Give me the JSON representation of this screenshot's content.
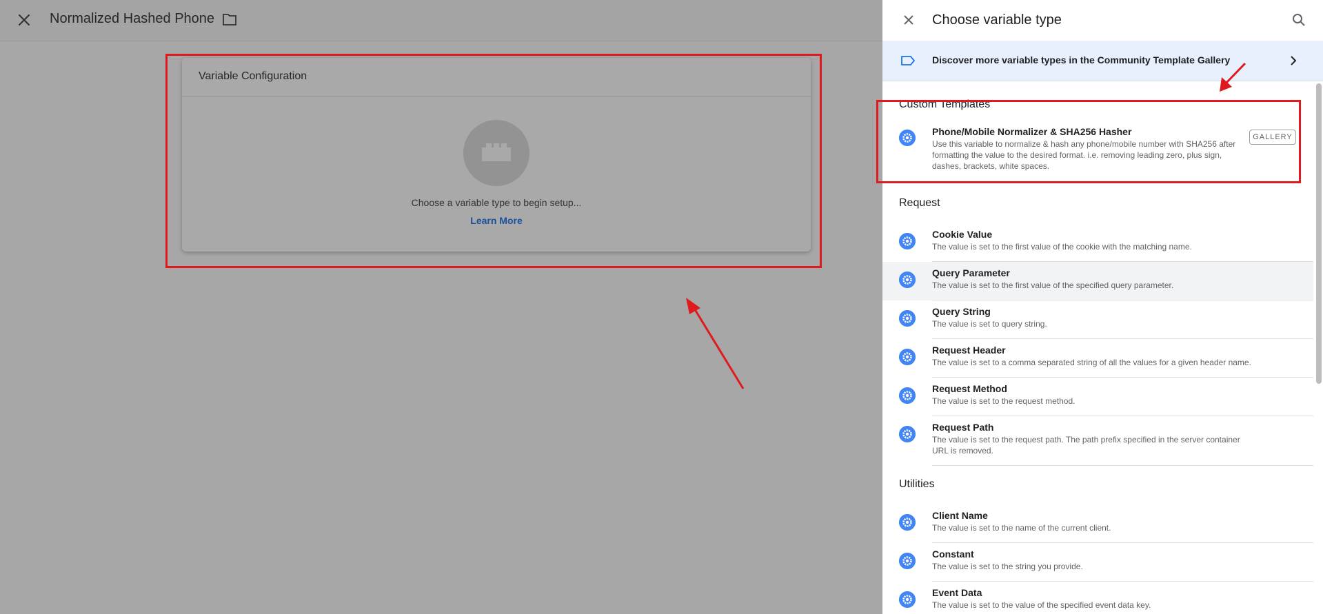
{
  "editor": {
    "title": "Normalized Hashed Phone",
    "card_title": "Variable Configuration",
    "hint": "Choose a variable type to begin setup...",
    "learn_more": "Learn More"
  },
  "panel": {
    "title": "Choose variable type",
    "banner_text": "Discover more variable types in the Community Template Gallery",
    "sections": {
      "custom": "Custom Templates",
      "request": "Request",
      "utilities": "Utilities"
    },
    "custom_item": {
      "name": "Phone/Mobile Normalizer & SHA256 Hasher",
      "desc": "Use this variable to normalize & hash any phone/mobile number with SHA256 after formatting the value to the desired format. i.e. removing leading zero, plus sign, dashes, brackets, white spaces.",
      "gallery_label": "GALLERY"
    },
    "request_items": [
      {
        "name": "Cookie Value",
        "desc": "The value is set to the first value of the cookie with the matching name."
      },
      {
        "name": "Query Parameter",
        "desc": "The value is set to the first value of the specified query parameter."
      },
      {
        "name": "Query String",
        "desc": "The value is set to query string."
      },
      {
        "name": "Request Header",
        "desc": "The value is set to a comma separated string of all the values for a given header name."
      },
      {
        "name": "Request Method",
        "desc": "The value is set to the request method."
      },
      {
        "name": "Request Path",
        "desc": "The value is set to the request path. The path prefix specified in the server container URL is removed."
      }
    ],
    "utility_items": [
      {
        "name": "Client Name",
        "desc": "The value is set to the name of the current client."
      },
      {
        "name": "Constant",
        "desc": "The value is set to the string you provide."
      },
      {
        "name": "Event Data",
        "desc": "The value is set to the value of the specified event data key."
      }
    ]
  },
  "colors": {
    "annotation_red": "#e0191f",
    "accent_blue": "#4285f4",
    "link_blue": "#1a4fa0"
  },
  "icons": [
    "close-icon",
    "folder-icon",
    "brick-icon",
    "search-icon",
    "tag-icon",
    "chevron-right-icon",
    "gear-icon"
  ]
}
